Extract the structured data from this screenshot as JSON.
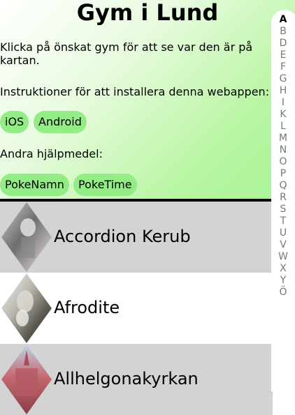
{
  "header": {
    "title": "Gym i Lund",
    "intro": "Klicka på önskat gym för att se var den är på kartan.",
    "install_text": "Instruktioner för att installera denna webappen:",
    "install_buttons": [
      "iOS",
      "Android"
    ],
    "tools_text": "Andra hjälpmedel:",
    "tool_buttons": [
      "PokeNamn",
      "PokeTime"
    ]
  },
  "gyms": [
    {
      "name": "Accordion Kerub"
    },
    {
      "name": "Afrodite"
    },
    {
      "name": "Allhelgonakyrkan"
    }
  ],
  "alphabet": [
    "A",
    "B",
    "D",
    "E",
    "F",
    "G",
    "H",
    "I",
    "K",
    "L",
    "M",
    "N",
    "O",
    "P",
    "Q",
    "R",
    "S",
    "T",
    "U",
    "V",
    "W",
    "X",
    "Y",
    "Ö"
  ],
  "alphabet_active": "A",
  "colors": {
    "pill": "#93ec86",
    "header_gradient_end": "#a8f396",
    "row_gray": "#d3d3d3",
    "divider": "#000000"
  }
}
